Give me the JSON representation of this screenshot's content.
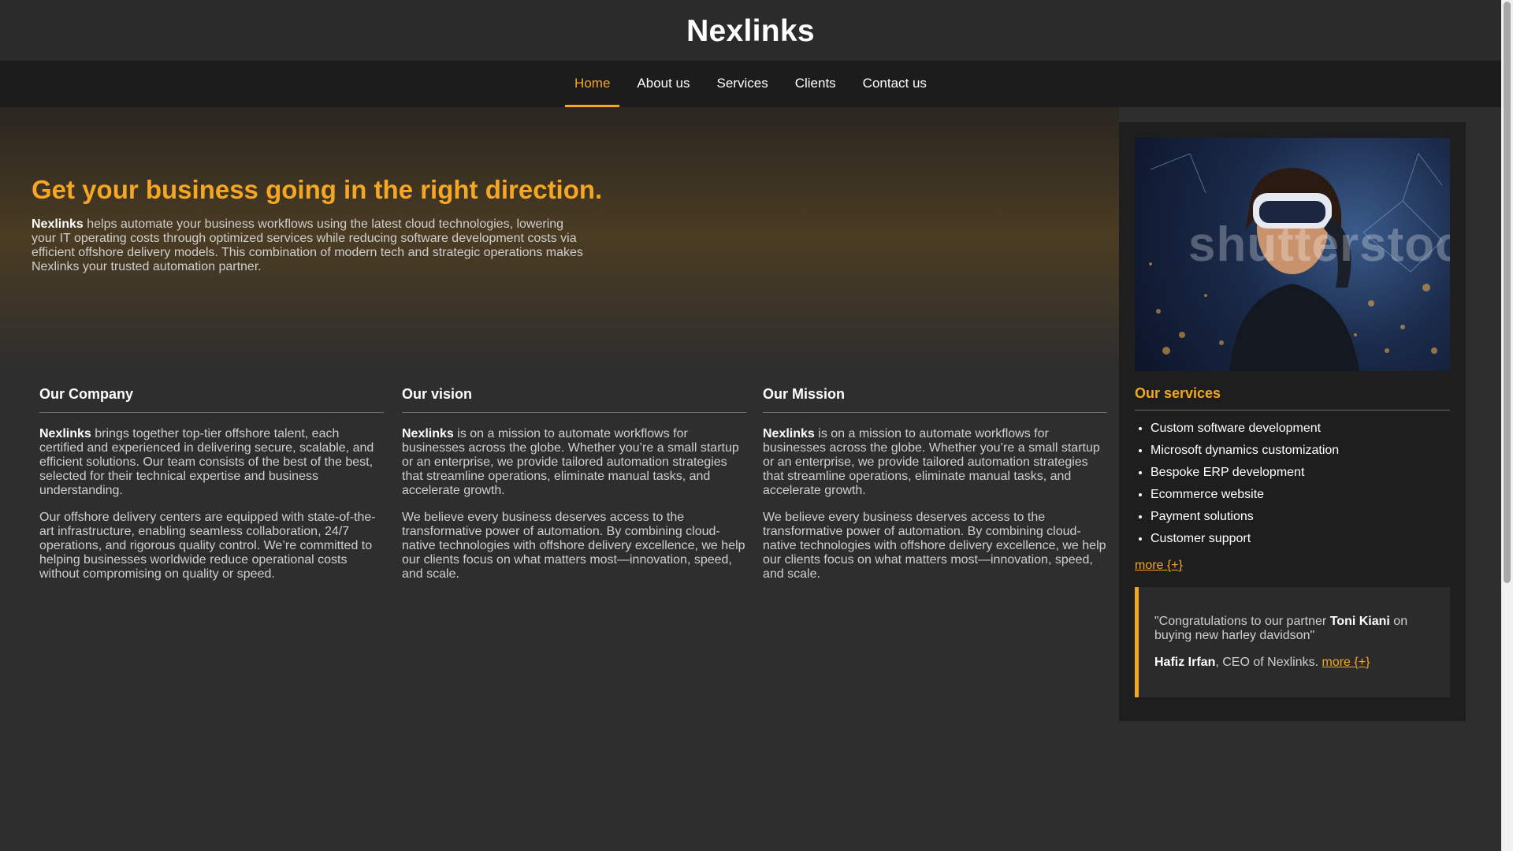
{
  "header": {
    "brand": "Nexlinks"
  },
  "nav": {
    "items": [
      {
        "label": "Home",
        "active": true
      },
      {
        "label": "About us"
      },
      {
        "label": "Services"
      },
      {
        "label": "Clients"
      },
      {
        "label": "Contact us"
      }
    ]
  },
  "hero": {
    "title": "Get your business going in the right direction.",
    "brand_bold": "Nexlinks",
    "text": " helps automate your business workflows using the latest cloud technologies, lowering your IT operating costs through optimized services while reducing software development costs via efficient offshore delivery models. This combination of modern tech and strategic operations makes Nexlinks your trusted automation partner."
  },
  "company": {
    "title": "Our Company",
    "p1_bold": "Nexlinks",
    "p1": " brings together top-tier offshore talent, each certified and experienced in delivering secure, scalable, and efficient solutions. Our team consists of the best of the best, selected for their technical expertise and business understanding.",
    "p2": "Our offshore delivery centers are equipped with state-of-the-art infrastructure, enabling seamless collaboration, 24/7 operations, and rigorous quality control. We’re committed to helping businesses worldwide reduce operational costs without compromising on quality or speed."
  },
  "vision": {
    "title": "Our vision",
    "p1_bold": "Nexlinks",
    "p1": " is on a mission to automate workflows for businesses across the globe. Whether you’re a small startup or an enterprise, we provide tailored automation strategies that streamline operations, eliminate manual tasks, and accelerate growth.",
    "p2": "We believe every business deserves access to the transformative power of automation. By combining cloud-native technologies with offshore delivery excellence, we help our clients focus on what matters most—innovation, speed, and scale."
  },
  "mission": {
    "title": "Our Mission",
    "p1_bold": "Nexlinks",
    "p1": " is on a mission to automate workflows for businesses across the globe. Whether you’re a small startup or an enterprise, we provide tailored automation strategies that streamline operations, eliminate manual tasks, and accelerate growth.",
    "p2": "We believe every business deserves access to the transformative power of automation. By combining cloud-native technologies with offshore delivery excellence, we help our clients focus on what matters most—innovation, speed, and scale."
  },
  "sidebar": {
    "image_watermark": "shutterstock",
    "services_title": "Our services",
    "services": [
      "Custom software development",
      "Microsoft dynamics customization",
      "Bespoke ERP development",
      "Ecommerce website",
      "Payment solutions",
      "Customer support"
    ],
    "more_label": "more {+}",
    "testimonial": {
      "quote_start": "\"Congratulations to our partner ",
      "partner_name": "Toni Kiani",
      "quote_end": " on buying new harley davidson\"",
      "author_name": "Hafiz Irfan",
      "author_role": ", CEO of Nexlinks. ",
      "more_label": "more {+}"
    }
  },
  "colors": {
    "accent": "#f5a623",
    "nav_bg": "#1c1c1c",
    "page_bg": "#2e2e2e"
  }
}
